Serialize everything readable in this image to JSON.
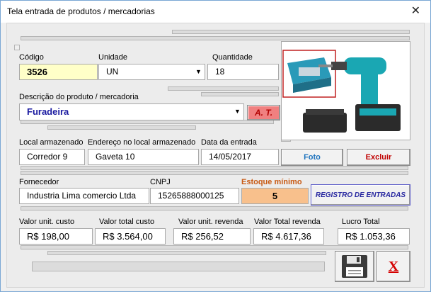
{
  "window": {
    "title": "Tela entrada de produtos / mercadorias",
    "close_glyph": "✕"
  },
  "produto": {
    "codigo_label": "Código",
    "codigo": "3526",
    "unidade_label": "Unidade",
    "unidade": "UN",
    "quantidade_label": "Quantidade",
    "quantidade": "18",
    "descricao_label": "Descrição do produto / mercadoria",
    "descricao": "Furadeira",
    "at_button": "A. T."
  },
  "armazenamento": {
    "local_label": "Local armazenado",
    "local": "Corredor 9",
    "endereco_label": "Endereço no local armazenado",
    "endereco": "Gaveta 10",
    "data_label": "Data da entrada",
    "data": "14/05/2017"
  },
  "foto_buttons": {
    "foto": "Foto",
    "excluir": "Excluir"
  },
  "fornecedor": {
    "fornecedor_label": "Fornecedor",
    "fornecedor": "Industria Lima comercio Ltda",
    "cnpj_label": "CNPJ",
    "cnpj": "15265888000125",
    "estoque_label": "Estoque mínimo",
    "estoque": "5",
    "registro_button": "REGISTRO DE ENTRADAS"
  },
  "valores": {
    "unit_custo_label": "Valor unit. custo",
    "unit_custo": "R$ 198,00",
    "total_custo_label": "Valor total custo",
    "total_custo": "R$ 3.564,00",
    "unit_revenda_label": "Valor unit. revenda",
    "unit_revenda": "R$ 256,52",
    "total_revenda_label": "Valor Total revenda",
    "total_revenda": "R$ 4.617,36",
    "lucro_label": "Lucro Total",
    "lucro": "R$ 1.053,36"
  },
  "footer": {
    "save_icon": "floppy-disk-icon",
    "close_label": "X"
  },
  "colors": {
    "codigo_bg": "#ffffc8",
    "descricao_text": "#1a1aa0",
    "at_bg": "#f08080",
    "foto_text": "#1e73be",
    "excluir_text": "#c00000",
    "estoque_bg": "#f8c08c",
    "estoque_label": "#c85a14",
    "registro_text": "#2828a0",
    "close_x": "#d40000"
  }
}
